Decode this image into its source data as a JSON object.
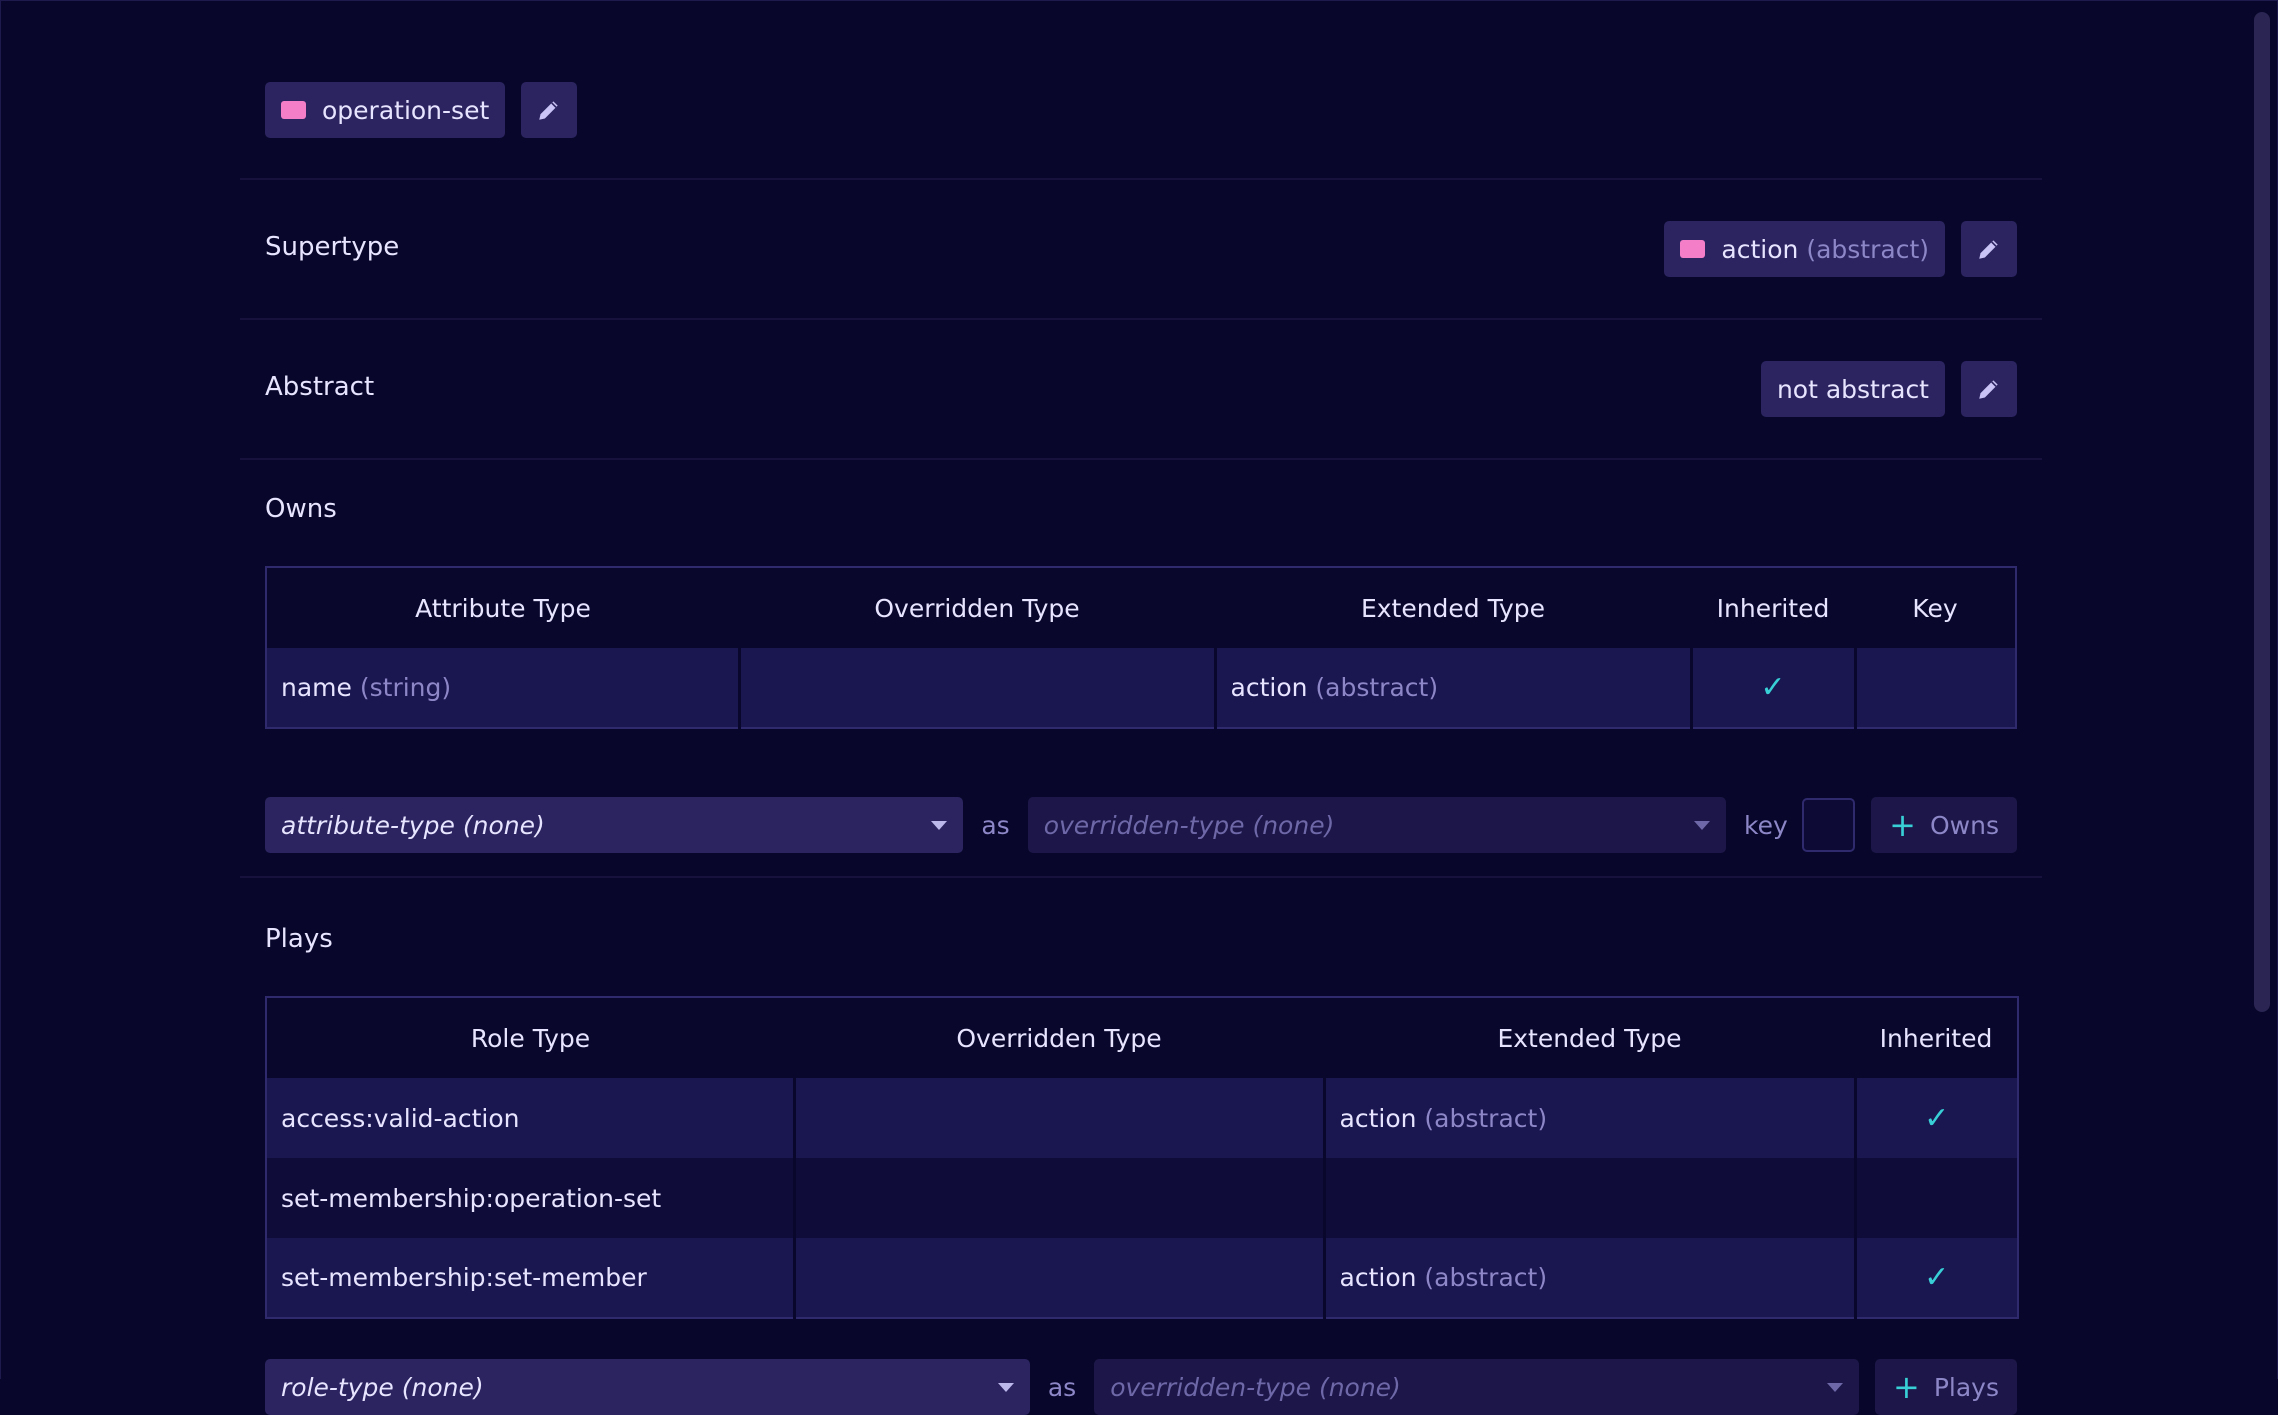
{
  "header": {
    "type_name": "operation-set"
  },
  "supertype": {
    "label": "Supertype",
    "value": "action",
    "qualifier": "(abstract)"
  },
  "abstract": {
    "label": "Abstract",
    "value": "not abstract"
  },
  "owns": {
    "label": "Owns",
    "columns": [
      "Attribute Type",
      "Overridden Type",
      "Extended Type",
      "Inherited",
      "Key"
    ],
    "rows": [
      {
        "attribute": "name",
        "attribute_qualifier": "(string)",
        "overridden": "",
        "extended": "action",
        "extended_qualifier": "(abstract)",
        "inherited": true,
        "key": false
      }
    ],
    "form": {
      "attribute_placeholder": "attribute-type (none)",
      "as_label": "as",
      "overridden_placeholder": "overridden-type (none)",
      "key_label": "key",
      "add_label": "Owns"
    }
  },
  "plays": {
    "label": "Plays",
    "columns": [
      "Role Type",
      "Overridden Type",
      "Extended Type",
      "Inherited"
    ],
    "rows": [
      {
        "role": "access:valid-action",
        "overridden": "",
        "extended": "action",
        "extended_qualifier": "(abstract)",
        "inherited": true
      },
      {
        "role": "set-membership:operation-set",
        "overridden": "",
        "extended": "",
        "extended_qualifier": "",
        "inherited": false
      },
      {
        "role": "set-membership:set-member",
        "overridden": "",
        "extended": "action",
        "extended_qualifier": "(abstract)",
        "inherited": true
      }
    ],
    "form": {
      "role_placeholder": "role-type (none)",
      "as_label": "as",
      "overridden_placeholder": "overridden-type (none)",
      "add_label": "Plays"
    }
  },
  "icons": {
    "edit": "pencil-icon",
    "check": "checkmark-icon",
    "add": "plus-icon",
    "caret": "chevron-down-icon"
  },
  "colors": {
    "background": "#08062a",
    "accent_pink": "#f47fc8",
    "accent_teal": "#38d0d6",
    "panel": "#2b2460"
  }
}
